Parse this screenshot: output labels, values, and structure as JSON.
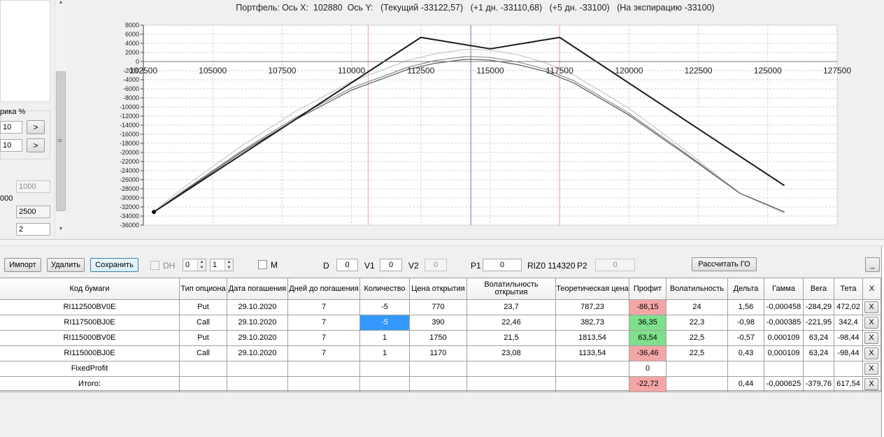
{
  "left_panel": {
    "label_pct": "рика %",
    "field1": "10",
    "field2": "10",
    "next1": ">",
    "next2": ">",
    "dis_field": "1000",
    "label_000": "000",
    "field3": "2500",
    "field4": "2"
  },
  "chart_title": "Портфель: Ось X:  102880  Ось Y:   (Текущий -33122,57)   (+1 дн. -33110,68)   (+5 дн. -33100)   (На экспирацию -33100)",
  "chart_data": {
    "type": "line",
    "title": "Портфель: Ось X:  102880  Ось Y:   (Текущий -33122,57)   (+1 дн. -33110,68)   (+5 дн. -33100)   (На экспирацию -33100)",
    "xlabel": "",
    "ylabel": "",
    "xlim": [
      102500,
      127500
    ],
    "ylim": [
      -36000,
      8000
    ],
    "x_ticks": [
      "102500",
      "105000",
      "107500",
      "110000",
      "112500",
      "115000",
      "117500",
      "120000",
      "122500",
      "125000",
      "127500"
    ],
    "y_ticks": [
      "8000",
      "6000",
      "4000",
      "2000",
      "0",
      "-2000",
      "-4000",
      "-6000",
      "-8000",
      "-10000",
      "-12000",
      "-14000",
      "-16000",
      "-18000",
      "-20000",
      "-22000",
      "-24000",
      "-26000",
      "-28000",
      "-30000",
      "-32000",
      "-34000",
      "-36000"
    ],
    "grid": true,
    "vlines": [
      {
        "x": 110600,
        "color": "#f0a0a0"
      },
      {
        "x": 114300,
        "color": "#6080a8"
      },
      {
        "x": 117500,
        "color": "#f0a0a0"
      }
    ],
    "marker": {
      "x": 102880,
      "y": -33100
    },
    "series": [
      {
        "color": "#1a1a1a",
        "width": 2,
        "x": [
          102880,
          112500,
          115000,
          117500,
          125600
        ],
        "y": [
          -33100,
          5300,
          2800,
          5300,
          -27300
        ]
      },
      {
        "color": "#c8c8c8",
        "width": 1.2,
        "x": [
          102880,
          104000,
          106000,
          108000,
          110000,
          112000,
          113000,
          114000,
          114300,
          115000,
          116000,
          117000,
          118000,
          120000,
          122000,
          124000,
          125600
        ],
        "y": [
          -33000,
          -27500,
          -18700,
          -10900,
          -4400,
          200,
          1700,
          2600,
          2700,
          2500,
          1500,
          -300,
          -2900,
          -10300,
          -19400,
          -29000,
          -33400
        ]
      },
      {
        "color": "#8a8a8a",
        "width": 1.2,
        "x": [
          102880,
          104000,
          106000,
          108000,
          110000,
          112000,
          113000,
          114000,
          114300,
          115000,
          116000,
          117000,
          118000,
          120000,
          122000,
          124000,
          125600
        ],
        "y": [
          -33100,
          -28200,
          -19800,
          -12300,
          -5800,
          -1300,
          200,
          1000,
          1100,
          900,
          -100,
          -1700,
          -4200,
          -11400,
          -20000,
          -29000,
          -33100
        ]
      },
      {
        "color": "#555555",
        "width": 1.2,
        "x": [
          102880,
          104000,
          106000,
          108000,
          110000,
          112000,
          113000,
          114000,
          114300,
          115000,
          116000,
          117000,
          118000,
          120000,
          122000,
          124000,
          125600
        ],
        "y": [
          -33120,
          -28400,
          -20100,
          -12700,
          -6300,
          -1800,
          -400,
          400,
          500,
          300,
          -700,
          -2200,
          -4700,
          -11800,
          -20300,
          -29000,
          -33100
        ]
      }
    ]
  },
  "toolbar": {
    "import": "Импорт",
    "delete": "Удалить",
    "save": "Сохранить",
    "dh_label": "DH",
    "spin1": "0",
    "spin2": "1",
    "m_label": "M",
    "d_label": "D",
    "d_value": "0",
    "v1_label": "V1",
    "v1_value": "0",
    "v2_label": "V2",
    "v2_value": "0",
    "p1_label": "P1",
    "p1_value": "0",
    "riz_text": "RIZ0 114320",
    "p2_label": "P2",
    "p2_value": "0",
    "calc_go": "Рассчитать ГО",
    "minimize": "_"
  },
  "table": {
    "headers": [
      "Код бумаги",
      "Тип опциона",
      "Дата погашения",
      "Дней до погашения",
      "Количество",
      "Цена открытия",
      "Волатильность открытия",
      "Теоретическая цена",
      "Профит",
      "Волатильность",
      "Дельта",
      "Гамма",
      "Вега",
      "Тета",
      "X"
    ],
    "rows": [
      [
        "RI112500BV0E",
        "Put",
        "29.10.2020",
        "7",
        "-5",
        "770",
        "23,7",
        "787,23",
        "-86,15",
        "24",
        "1,56",
        "-0,000458",
        "-284,29",
        "472,02",
        "X"
      ],
      [
        "RI117500BJ0E",
        "Call",
        "29.10.2020",
        "7",
        "-5",
        "390",
        "22,46",
        "382,73",
        "36,35",
        "22,3",
        "-0,98",
        "-0,000385",
        "-221,95",
        "342,4",
        "X"
      ],
      [
        "RI115000BV0E",
        "Put",
        "29.10.2020",
        "7",
        "1",
        "1750",
        "21,5",
        "1813,54",
        "63,54",
        "22,5",
        "-0,57",
        "0,000109",
        "63,24",
        "-98,44",
        "X"
      ],
      [
        "RI115000BJ0E",
        "Call",
        "29.10.2020",
        "7",
        "1",
        "1170",
        "23,08",
        "1133,54",
        "-36,46",
        "22,5",
        "0,43",
        "0,000109",
        "63,24",
        "-98,44",
        "X"
      ],
      [
        "FixedProfit",
        "",
        "",
        "",
        "",
        "",
        "",
        "",
        "0",
        "",
        "",
        "",
        "",
        "",
        "X"
      ],
      [
        "Итого:",
        "",
        "",
        "",
        "",
        "",
        "",
        "",
        "-22,72",
        "",
        "0,44",
        "-0,000625",
        "-379,76",
        "617,54",
        "X"
      ]
    ],
    "profit_colors": [
      "#f4a6a6",
      "#7ee08c",
      "#7ee08c",
      "#f4a6a6",
      "",
      "#f4a6a6"
    ],
    "selected_color": "#3399ff"
  }
}
